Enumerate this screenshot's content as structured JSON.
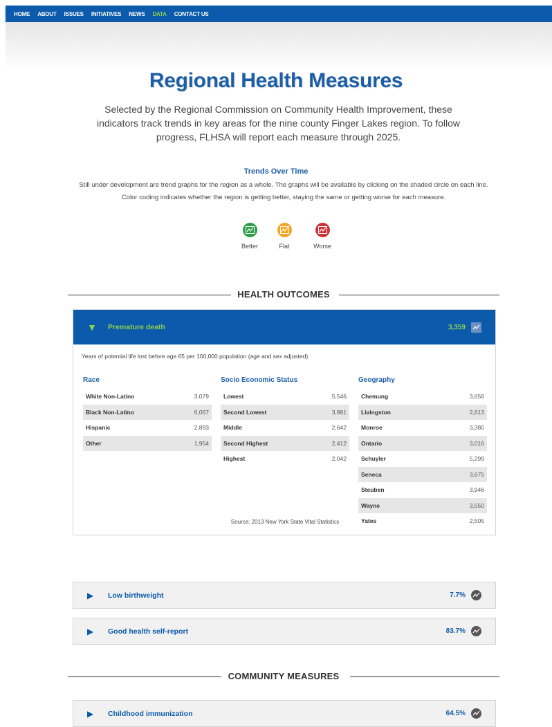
{
  "nav": {
    "items": [
      {
        "label": "HOME",
        "active": false
      },
      {
        "label": "ABOUT",
        "active": false
      },
      {
        "label": "ISSUES",
        "active": false
      },
      {
        "label": "INITIATIVES",
        "active": false
      },
      {
        "label": "NEWS",
        "active": false
      },
      {
        "label": "DATA",
        "active": true
      },
      {
        "label": "CONTACT US",
        "active": false
      }
    ]
  },
  "page": {
    "title": "Regional Health Measures",
    "intro": "Selected by the Regional Commission on Community Health Improvement, these indicators track trends in key areas for the nine county Finger Lakes region. To follow progress, FLHSA will report each measure through 2025."
  },
  "trends": {
    "title": "Trends Over Time",
    "description": "Still under development are trend graphs for the region as a whole. The graphs will be available by clicking on the shaded circle on each line. Color coding indicates whether the region is getting better, staying the same or getting worse for each measure.",
    "legend": [
      {
        "label": "Better",
        "color": "#2e9e47",
        "icon": "trend-better-icon"
      },
      {
        "label": "Flat",
        "color": "#f5a623",
        "icon": "trend-flat-icon"
      },
      {
        "label": "Worse",
        "color": "#cf3339",
        "icon": "trend-worse-icon"
      }
    ]
  },
  "sections": {
    "health_outcomes": "HEALTH OUTCOMES",
    "community_measures": "COMMUNITY MEASURES"
  },
  "premature_death": {
    "name": "Premature death",
    "value": "3,359",
    "description": "Years of potential life lost before age 65 per 100,000 population (age and sex adjusted)",
    "race": {
      "title": "Race",
      "rows": [
        {
          "label": "White Non-Latino",
          "value": "3,079"
        },
        {
          "label": "Black Non-Latino",
          "value": "6,067"
        },
        {
          "label": "Hispanic",
          "value": "2,893"
        },
        {
          "label": "Other",
          "value": "1,954"
        }
      ]
    },
    "ses": {
      "title": "Socio Economic Status",
      "rows": [
        {
          "label": "Lowest",
          "value": "5,546"
        },
        {
          "label": "Second Lowest",
          "value": "3,981"
        },
        {
          "label": "Middle",
          "value": "2,642"
        },
        {
          "label": "Second Highest",
          "value": "2,412"
        },
        {
          "label": "Highest",
          "value": "2,042"
        }
      ]
    },
    "geography": {
      "title": "Geography",
      "rows": [
        {
          "label": "Chemung",
          "value": "3,656"
        },
        {
          "label": "Livingston",
          "value": "2,613"
        },
        {
          "label": "Monroe",
          "value": "3,380"
        },
        {
          "label": "Ontario",
          "value": "3,016"
        },
        {
          "label": "Schuyler",
          "value": "5,299"
        },
        {
          "label": "Seneca",
          "value": "3,675"
        },
        {
          "label": "Steuben",
          "value": "3,946"
        },
        {
          "label": "Wayne",
          "value": "3,550"
        },
        {
          "label": "Yates",
          "value": "2,505"
        }
      ]
    },
    "source": "Source: 2013 New York State Vital Statistics"
  },
  "measures": {
    "low_birthweight": {
      "name": "Low birthweight",
      "value": "7.7%"
    },
    "good_health": {
      "name": "Good health self-report",
      "value": "83.7%"
    },
    "childhood_immunization": {
      "name": "Childhood immunization",
      "value": "64.5%"
    }
  },
  "symbols": {
    "expanded": "▼",
    "collapsed": "▶"
  }
}
